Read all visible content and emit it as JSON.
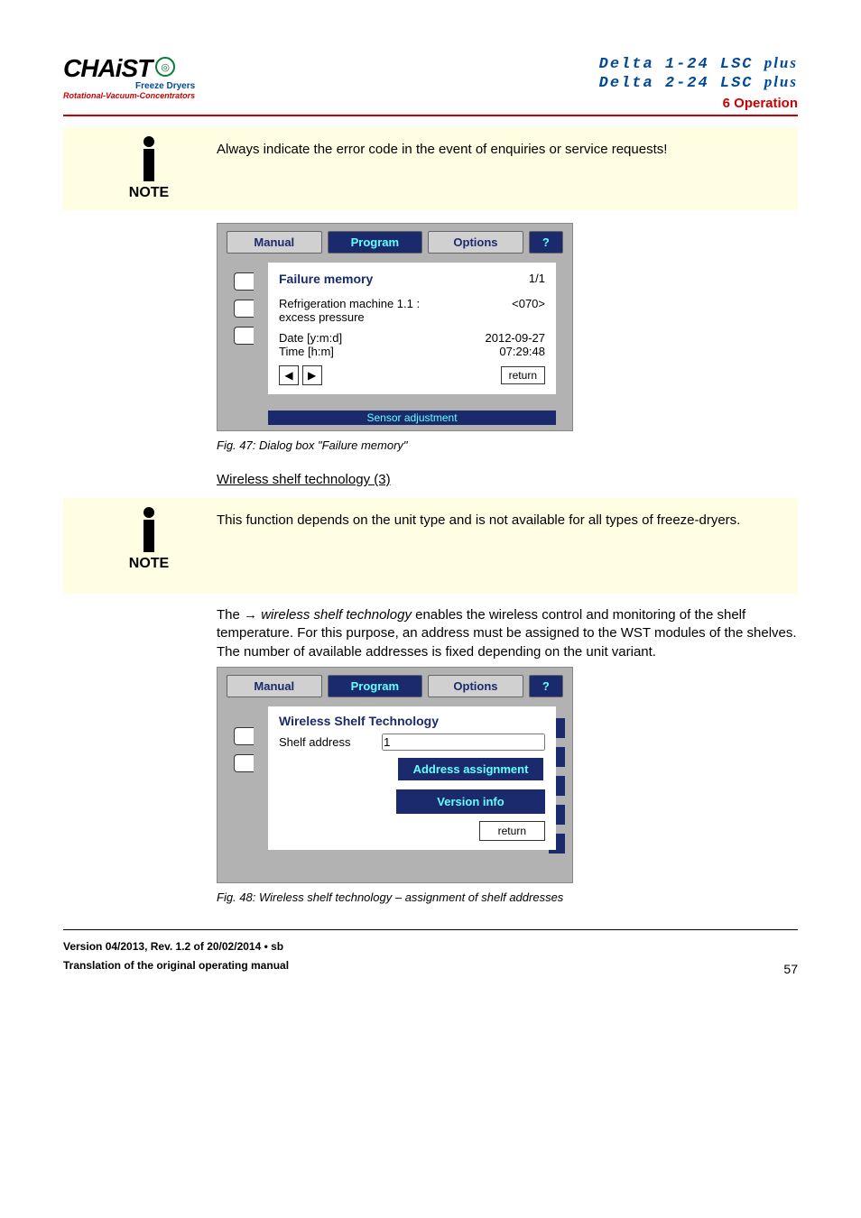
{
  "logo": {
    "text": "CHAiST",
    "sub1": "Freeze Dryers",
    "sub2": "Rotational-Vacuum-Concentrators"
  },
  "title": {
    "line1_a": "Delta 1-24 LSC ",
    "line1_b": "plus",
    "line2_a": "Delta 2-24 LSC ",
    "line2_b": "plus",
    "section": "6 Operation"
  },
  "note1": {
    "label": "NOTE",
    "text": "Always indicate the error code in the event of enquiries or service requests!"
  },
  "dialog1": {
    "tabs": {
      "manual": "Manual",
      "program": "Program",
      "options": "Options",
      "help": "?"
    },
    "panel_title": "Failure memory",
    "page": "1/1",
    "row1_l": "Refrigeration machine 1.1 :\nexcess pressure",
    "row1_r": "<070>",
    "row2_l_a": "Date [y:m:d]",
    "row2_l_b": "Time [h:m]",
    "row2_r_a": "2012-09-27",
    "row2_r_b": "07:29:48",
    "return": "return",
    "strip": "Sensor adjustment",
    "arrow_l": "◀",
    "arrow_r": "▶"
  },
  "fig1": "Fig. 47: Dialog box \"Failure memory\"",
  "heading_wst": "Wireless shelf technology (3)",
  "note2": {
    "label": "NOTE",
    "text": "This function depends on the unit type and is not available for all types of freeze-dryers."
  },
  "para1_a": "The → ",
  "para1_b": "wireless shelf technology",
  "para1_c": " enables the wireless control and monitoring of the shelf temperature. For this purpose, an address must be assigned to the WST modules of the shelves. The number of available addresses is fixed depending on the unit variant.",
  "dialog2": {
    "tabs": {
      "manual": "Manual",
      "program": "Program",
      "options": "Options",
      "help": "?"
    },
    "panel_title": "Wireless Shelf Technology",
    "shelf_label": "Shelf address",
    "shelf_value": "1",
    "assign": "Address assignment",
    "version": "Version info",
    "return": "return"
  },
  "fig2": "Fig. 48: Wireless shelf technology – assignment of shelf addresses",
  "footer": {
    "l1": "Version 04/2013, Rev. 1.2 of 20/02/2014 • sb",
    "l2": "Translation of the original operating manual",
    "page": "57"
  }
}
